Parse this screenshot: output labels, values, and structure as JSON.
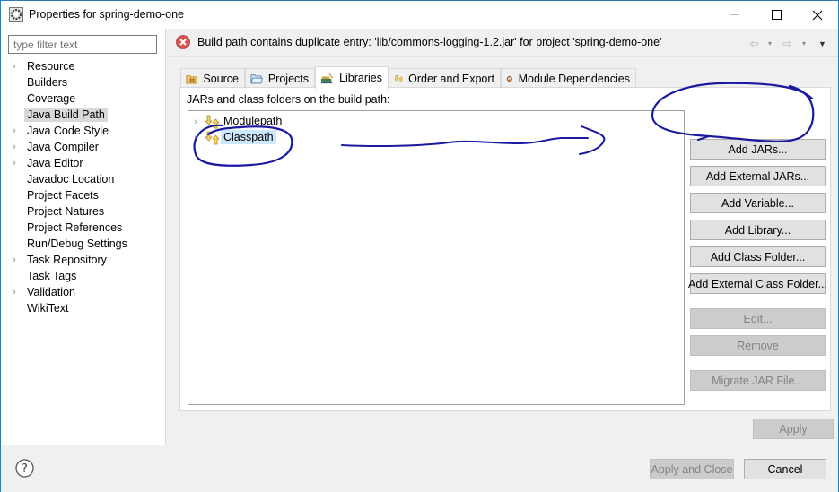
{
  "window": {
    "title": "Properties for spring-demo-one",
    "controls": {
      "minimize": "—",
      "maximize": "☐",
      "close": "✕"
    }
  },
  "sidebar": {
    "filter_placeholder": "type filter text",
    "items": [
      {
        "label": "Resource",
        "expandable": true,
        "selected": false
      },
      {
        "label": "Builders",
        "expandable": false,
        "selected": false
      },
      {
        "label": "Coverage",
        "expandable": false,
        "selected": false
      },
      {
        "label": "Java Build Path",
        "expandable": false,
        "selected": true
      },
      {
        "label": "Java Code Style",
        "expandable": true,
        "selected": false
      },
      {
        "label": "Java Compiler",
        "expandable": true,
        "selected": false
      },
      {
        "label": "Java Editor",
        "expandable": true,
        "selected": false
      },
      {
        "label": "Javadoc Location",
        "expandable": false,
        "selected": false
      },
      {
        "label": "Project Facets",
        "expandable": false,
        "selected": false
      },
      {
        "label": "Project Natures",
        "expandable": false,
        "selected": false
      },
      {
        "label": "Project References",
        "expandable": false,
        "selected": false
      },
      {
        "label": "Run/Debug Settings",
        "expandable": false,
        "selected": false
      },
      {
        "label": "Task Repository",
        "expandable": true,
        "selected": false
      },
      {
        "label": "Task Tags",
        "expandable": false,
        "selected": false
      },
      {
        "label": "Validation",
        "expandable": true,
        "selected": false
      },
      {
        "label": "WikiText",
        "expandable": false,
        "selected": false
      }
    ]
  },
  "message": {
    "icon": "error-icon",
    "text": "Build path contains duplicate entry: 'lib/commons-logging-1.2.jar' for project 'spring-demo-one'"
  },
  "nav": {
    "back": "⇦",
    "forward": "⇨",
    "dropdown": "▾",
    "menu": "▼"
  },
  "tabs": [
    {
      "label": "Source",
      "icon": "source-folder-icon",
      "active": false
    },
    {
      "label": "Projects",
      "icon": "projects-folder-icon",
      "active": false
    },
    {
      "label": "Libraries",
      "icon": "libraries-icon",
      "active": true
    },
    {
      "label": "Order and Export",
      "icon": "order-export-icon",
      "active": false
    },
    {
      "label": "Module Dependencies",
      "icon": "module-dependencies-icon",
      "active": false
    }
  ],
  "libraries": {
    "heading": "JARs and class folders on the build path:",
    "entries": [
      {
        "label": "Modulepath",
        "selected": false
      },
      {
        "label": "Classpath",
        "selected": true
      }
    ],
    "buttons": [
      {
        "label": "Add JARs...",
        "enabled": true
      },
      {
        "label": "Add External JARs...",
        "enabled": true
      },
      {
        "label": "Add Variable...",
        "enabled": true
      },
      {
        "label": "Add Library...",
        "enabled": true
      },
      {
        "label": "Add Class Folder...",
        "enabled": true
      },
      {
        "label": "Add External Class Folder...",
        "enabled": true
      },
      {
        "label": "Edit...",
        "enabled": false
      },
      {
        "label": "Remove",
        "enabled": false
      },
      {
        "label": "Migrate JAR File...",
        "enabled": false
      }
    ]
  },
  "actions": {
    "apply": "Apply",
    "apply_and_close": "Apply and Close",
    "cancel": "Cancel",
    "help": "?"
  },
  "annotation": {
    "color": "#1a1aa0"
  }
}
